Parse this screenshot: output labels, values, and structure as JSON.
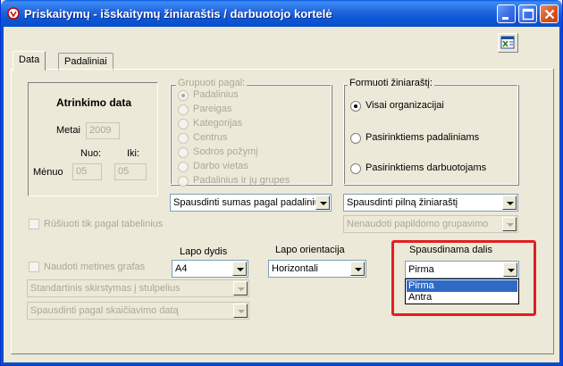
{
  "window": {
    "title": "Priskaitymų - išskaitymų žiniaraštis / darbuotojo kortelė",
    "colors": {
      "title_bar": "#0a5ae7",
      "highlight_box": "#e02020",
      "selection": "#316ac5"
    }
  },
  "toolbar": {
    "export_icon": "excel-export-icon"
  },
  "tabs": [
    {
      "label": "Data",
      "active": true
    },
    {
      "label": "Padaliniai",
      "active": false
    }
  ],
  "atrinkimo": {
    "title": "Atrinkimo data",
    "metai_label": "Metai",
    "metai_value": "2009",
    "nuo_label": "Nuo:",
    "iki_label": "Iki:",
    "menuo_label": "Mėnuo",
    "nuo_value": "05",
    "iki_value": "05"
  },
  "grupuoti": {
    "legend": "Grupuoti pagal:",
    "options": [
      "Padalinius",
      "Pareigas",
      "Kategorijas",
      "Centrus",
      "Sodros požymį",
      "Darbo vietas",
      "Padalinius ir jų grupes"
    ],
    "selected": 0
  },
  "formuoti": {
    "legend": "Formuoti žiniaraštį:",
    "options": [
      "Visai organizacijai",
      "Pasirinktiems padaliniams",
      "Pasirinktiems darbuotojams"
    ],
    "selected": 0
  },
  "spausdinti_sumas": {
    "value": "Spausdinti sumas pagal padaliniu:"
  },
  "spausdinti_pilna": {
    "value": "Spausdinti pilną žiniaraštį"
  },
  "nenaudoti": {
    "value": "Nenaudoti papildomo grupavimo"
  },
  "rusiuoti": {
    "label": "Rūšiuoti tik pagal tabelinius"
  },
  "naudoti": {
    "label": "Naudoti metines grafas"
  },
  "standartinis": {
    "value": "Standartinis skirstymas į stulpelius"
  },
  "spausdinti_data": {
    "value": "Spausdinti pagal skaičiavimo datą"
  },
  "lapo_dydis": {
    "label": "Lapo dydis",
    "value": "A4"
  },
  "lapo_orientacija": {
    "label": "Lapo orientacija",
    "value": "Horizontali"
  },
  "spausdinama_dalis": {
    "label": "Spausdinama dalis",
    "value": "Pirma",
    "options": [
      "Pirma",
      "Antra"
    ],
    "highlighted": 0
  }
}
